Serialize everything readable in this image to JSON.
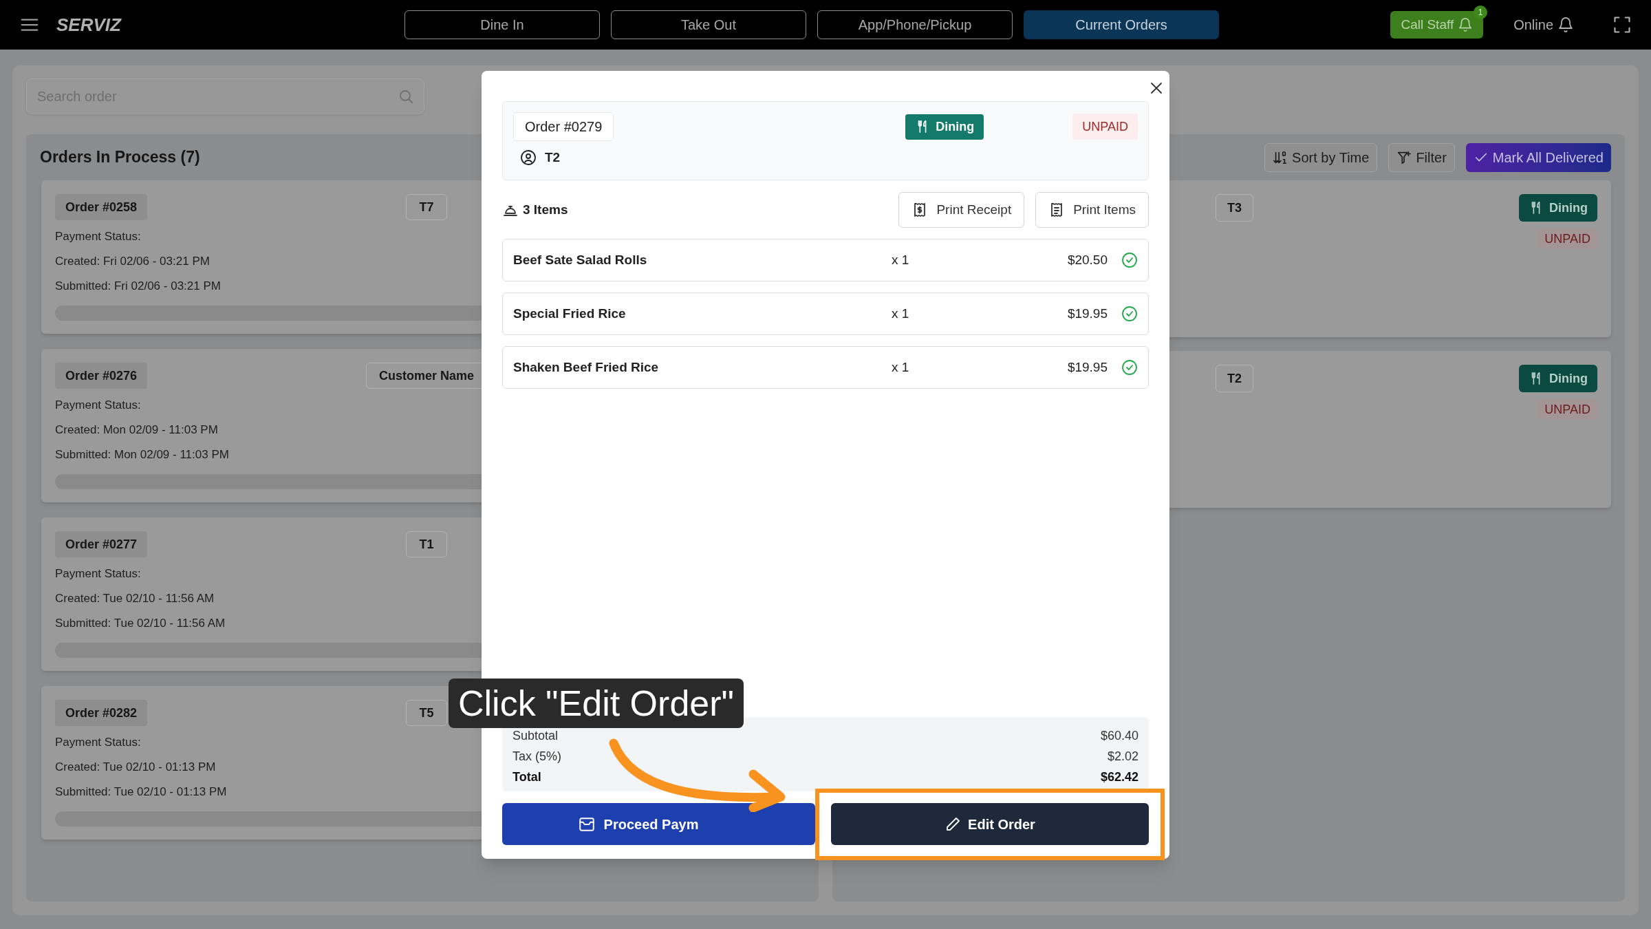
{
  "top_bar": {
    "brand": "SERVIZ",
    "tabs": [
      {
        "label": "Dine In",
        "selected": false
      },
      {
        "label": "Take Out",
        "selected": false
      },
      {
        "label": "App/Phone/Pickup",
        "selected": false
      },
      {
        "label": "Current Orders",
        "selected": true
      }
    ],
    "call_staff": {
      "label": "Call Staff",
      "badge": "1"
    },
    "status": "Online"
  },
  "search": {
    "placeholder": "Search order"
  },
  "in_process": {
    "title": "Orders In Process (7)",
    "orders": [
      {
        "order": "Order #0258",
        "tag": "T7",
        "payment": "Payment Status:",
        "created": "Created: Fri 02/06 - 03:21 PM",
        "submitted": "Submitted: Fri 02/06 - 03:21 PM"
      },
      {
        "order": "Order #0276",
        "tag": "Customer Name",
        "payment": "Payment Status:",
        "created": "Created: Mon 02/09 - 11:03 PM",
        "submitted": "Submitted: Mon 02/09 - 11:03 PM"
      },
      {
        "order": "Order #0277",
        "tag": "T1",
        "payment": "Payment Status:",
        "created": "Created: Tue 02/10 - 11:56 AM",
        "submitted": "Submitted: Tue 02/10 - 11:56 AM"
      },
      {
        "order": "Order #0282",
        "tag": "T5",
        "payment": "Payment Status:",
        "created": "Created: Tue 02/10 - 01:13 PM",
        "submitted": "Submitted: Tue 02/10 - 01:13 PM"
      }
    ]
  },
  "toolbar": [
    {
      "kind": "sort",
      "label": "Sort by Time"
    },
    {
      "kind": "filter",
      "label": "Filter"
    },
    {
      "kind": "deliver",
      "label": "Mark All Delivered"
    }
  ],
  "other_orders": [
    {
      "tag": "T3",
      "service": "Dining",
      "payment": "UNPAID"
    },
    {
      "tag": "T2",
      "service": "Dining",
      "payment": "UNPAID"
    }
  ],
  "modal": {
    "order": "Order #0279",
    "service": "Dining",
    "payment": "UNPAID",
    "table": "T2",
    "items_count": "3 Items",
    "actions": [
      {
        "kind": "receipt",
        "label": "Print Receipt"
      },
      {
        "kind": "items",
        "label": "Print Items"
      }
    ],
    "items": [
      {
        "name": "Beef Sate Salad Rolls",
        "qty": "x 1",
        "price": "$20.50",
        "done": true
      },
      {
        "name": "Special Fried Rice",
        "qty": "x 1",
        "price": "$19.95",
        "done": true
      },
      {
        "name": "Shaken Beef Fried Rice",
        "qty": "x 1",
        "price": "$19.95",
        "done": true
      }
    ],
    "totals": [
      {
        "label": "Subtotal",
        "value": "$60.40",
        "bold": false
      },
      {
        "label": "Tax (5%)",
        "value": "$2.02",
        "bold": false
      },
      {
        "label": "Total",
        "value": "$62.42",
        "bold": true
      }
    ],
    "pay_button": "Proceed Paym",
    "edit_button": "Edit Order"
  },
  "tutorial": {
    "callout": "Click \"Edit Order\""
  }
}
